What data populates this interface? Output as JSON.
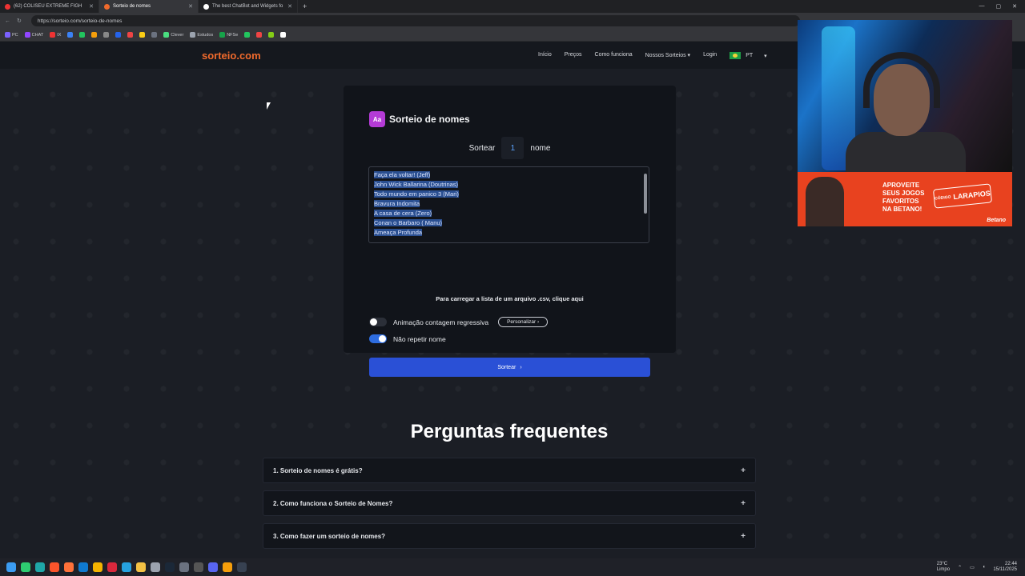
{
  "browser": {
    "tabs": [
      {
        "title": "(62) COLISEU EXTREME FIGH",
        "color": "#e33"
      },
      {
        "title": "Sorteio de nomes",
        "color": "#f06a2c"
      },
      {
        "title": "The best ChatBot and Widgets fo",
        "color": "#ffffff"
      }
    ],
    "url": "https://sorteio.com/sorteio-de-nomes",
    "bookmarks": [
      "PC",
      "CHAT",
      "IX",
      "Clever",
      "Estudos",
      "NFSe"
    ]
  },
  "site": {
    "logo": "sorteio.com",
    "nav": {
      "links": [
        "Início",
        "Preços",
        "Como funciona",
        "Nossos Sorteios",
        "Login"
      ],
      "dropdown_chevron": "⌄",
      "lang": "PT"
    },
    "card": {
      "icon_text": "Aa",
      "title": "Sorteio de nomes",
      "draw_label": "Sortear",
      "draw_count": "1",
      "draw_unit": "nome",
      "names": [
        "Faça ela voltar!  (Jeff)",
        "John Wick Ballarina (Doutrinas)",
        "Todo mundo em panico  3 (Mari)",
        "Bravura Indomita",
        "A casa de cera (Zero)",
        "Conan o Barbaro ( Manu)",
        "Ameaça Profunda"
      ],
      "csv_text": "Para carregar a lista de um arquivo .csv, clique aqui",
      "option_countdown": "Animação contagem regressiva",
      "option_countdown_on": false,
      "personalize_label": "Personalizar",
      "option_no_repeat": "Não repetir nome",
      "option_no_repeat_on": true,
      "submit_label": "Sortear"
    },
    "faq": {
      "title": "Perguntas frequentes",
      "items": [
        "1. Sorteio de nomes é grátis?",
        "2. Como funciona o Sorteio de Nomes?",
        "3. Como fazer um sorteio de nomes?"
      ],
      "expand_icon": "+"
    }
  },
  "overlay": {
    "ad_lines": [
      "APROVEITE",
      "SEUS JOGOS",
      "FAVORITOS",
      "NA BETANO!"
    ],
    "ad_code": "LARAPIOS",
    "ad_code_label": "CÓDIGO",
    "ad_brand": "Betano"
  },
  "taskbar": {
    "weather_temp": "23°C",
    "weather_desc": "Limpo",
    "time": "22:44",
    "date": "15/11/2025"
  },
  "colors": {
    "accent": "#2a50d6",
    "brand": "#f06a2c",
    "toggle_on": "#2e6de0"
  }
}
